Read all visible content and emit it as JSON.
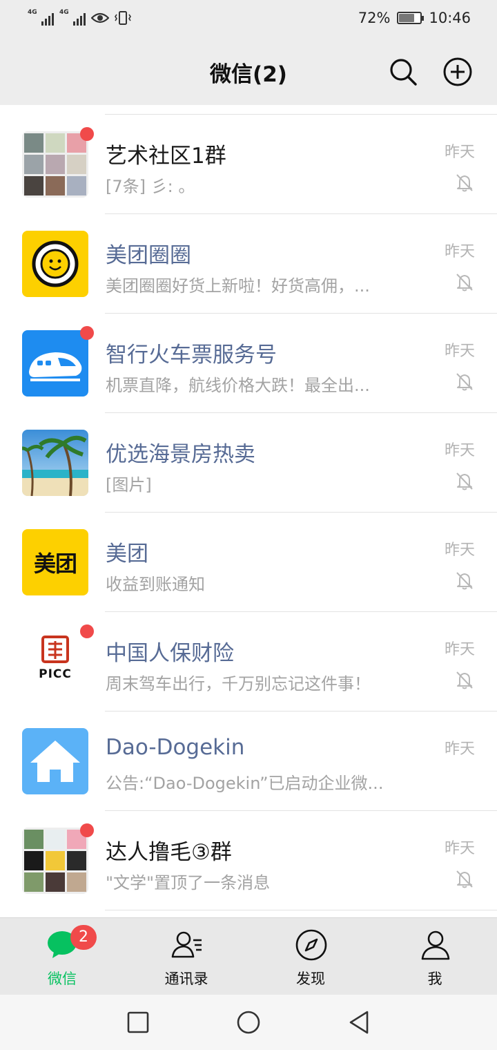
{
  "status_bar": {
    "signal1": "4G",
    "signal2": "4G",
    "battery_text": "72%",
    "battery_level": 0.72,
    "time": "10:46"
  },
  "header": {
    "title": "微信(2)",
    "search_icon": "search-icon",
    "add_icon": "plus-circle-icon"
  },
  "chats": [
    {
      "name": "艺术社区1群",
      "preview": "[7条] 彡: 。",
      "time": "昨天",
      "unread_dot": true,
      "muted": true,
      "name_style": "dark",
      "avatar": "group-grid-avatar"
    },
    {
      "name": "美团圈圈",
      "preview": "美团圈圈好货上新啦！好货高佣，...",
      "time": "昨天",
      "unread_dot": false,
      "muted": true,
      "name_style": "link",
      "avatar": "smiley-egg-avatar"
    },
    {
      "name": "智行火车票服务号",
      "preview": "机票直降，航线价格大跌！最全出...",
      "time": "昨天",
      "unread_dot": true,
      "muted": true,
      "name_style": "link",
      "avatar": "train-avatar"
    },
    {
      "name": "优选海景房热卖",
      "preview": "[图片]",
      "time": "昨天",
      "unread_dot": false,
      "muted": true,
      "name_style": "link",
      "avatar": "beach-avatar"
    },
    {
      "name": "美团",
      "preview": "收益到账通知",
      "time": "昨天",
      "unread_dot": false,
      "muted": true,
      "name_style": "link",
      "avatar": "meituan-avatar",
      "avatar_text": "美团"
    },
    {
      "name": "中国人保财险",
      "preview": "周末驾车出行，千万别忘记这件事！",
      "time": "昨天",
      "unread_dot": true,
      "muted": true,
      "name_style": "link",
      "avatar": "picc-avatar",
      "avatar_text": "PICC"
    },
    {
      "name": "Dao-Dogekin",
      "preview": "公告:“Dao-Dogekin”已启动企业微...",
      "time": "昨天",
      "unread_dot": false,
      "muted": false,
      "name_style": "link",
      "avatar": "house-avatar"
    },
    {
      "name": "达人撸毛③群",
      "preview": "\"文学\"置顶了一条消息",
      "time": "昨天",
      "unread_dot": true,
      "muted": true,
      "name_style": "dark",
      "avatar": "group-grid-avatar-2"
    }
  ],
  "tabbar": {
    "tabs": [
      {
        "label": "微信",
        "icon": "chat-bubbles-icon",
        "active": true,
        "badge": "2"
      },
      {
        "label": "通讯录",
        "icon": "contacts-icon",
        "active": false
      },
      {
        "label": "发现",
        "icon": "compass-icon",
        "active": false
      },
      {
        "label": "我",
        "icon": "person-icon",
        "active": false
      }
    ]
  },
  "navbar": {
    "buttons": [
      "recents-square-icon",
      "home-circle-icon",
      "back-triangle-icon"
    ]
  },
  "colors": {
    "accent_green": "#07c160",
    "badge_red": "#f04a4a",
    "link_blue": "#576b95"
  }
}
